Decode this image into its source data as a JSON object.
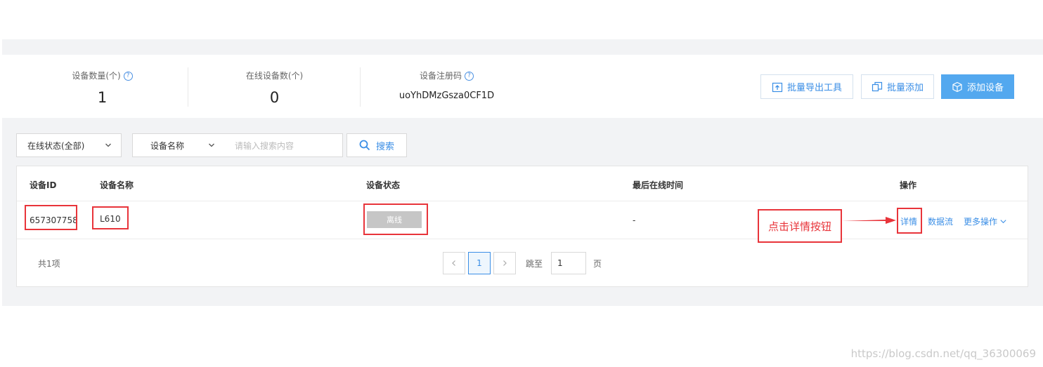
{
  "stats": {
    "device_count": {
      "label": "设备数量(个)",
      "value": "1"
    },
    "online_count": {
      "label": "在线设备数(个)",
      "value": "0"
    },
    "register_code": {
      "label": "设备注册码",
      "value": "uoYhDMzGsza0CF1D"
    }
  },
  "toolbar": {
    "bulk_export": "批量导出工具",
    "bulk_add": "批量添加",
    "add_device": "添加设备"
  },
  "filters": {
    "status_select": "在线状态(全部)",
    "field_select": "设备名称",
    "search_placeholder": "请输入搜索内容",
    "search_button": "搜索"
  },
  "table": {
    "headers": [
      "设备ID",
      "设备名称",
      "设备状态",
      "最后在线时间",
      "操作"
    ],
    "rows": [
      {
        "id": "657307758",
        "name": "L610",
        "status": "离线",
        "last_online": "-",
        "actions": {
          "detail": "详情",
          "datastream": "数据流",
          "more": "更多操作"
        }
      }
    ]
  },
  "pagination": {
    "total": "共1项",
    "current_page": "1",
    "jump_label": "跳至",
    "jump_value": "1",
    "page_suffix": "页"
  },
  "annotation": {
    "callout": "点击详情按钮"
  },
  "watermark": "https://blog.csdn.net/qq_36300069",
  "colors": {
    "accent": "#3a8ee6",
    "primary_button": "#53a8ef",
    "highlight": "#e8343a",
    "offline_badge": "#c6c6c6"
  }
}
